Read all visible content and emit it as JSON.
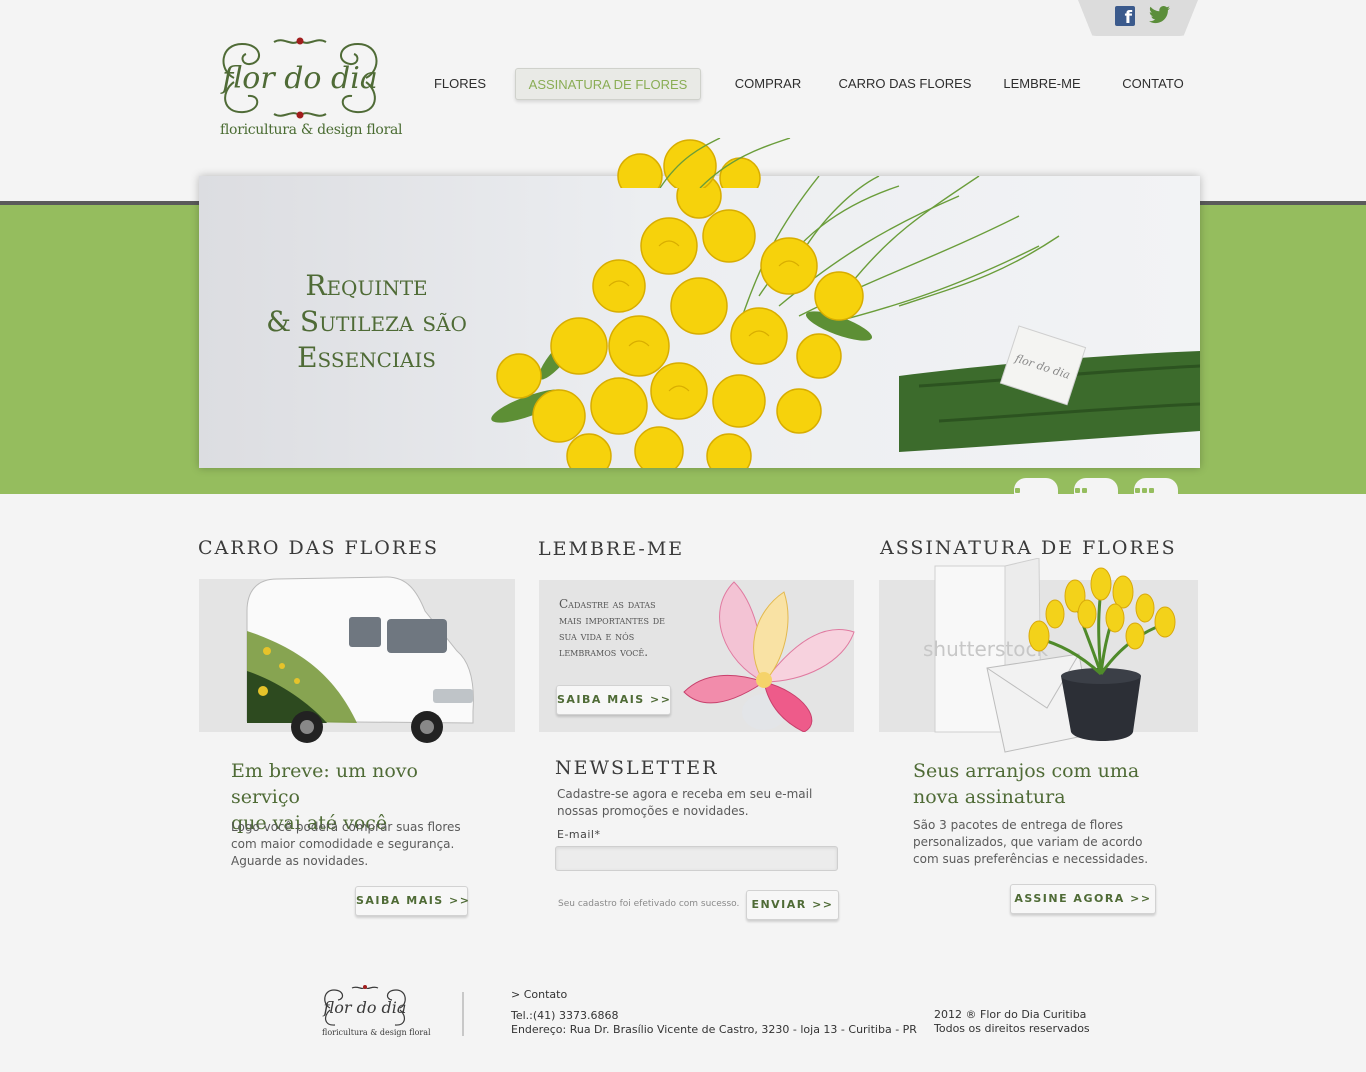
{
  "social": {
    "facebook": "f",
    "twitter": "facebook-twitter"
  },
  "logo": {
    "name": "flor do dia",
    "subtitle": "floricultura & design floral"
  },
  "nav": [
    {
      "label": "FLORES"
    },
    {
      "label": "ASSINATURA DE FLORES",
      "active": true
    },
    {
      "label": "COMPRAR"
    },
    {
      "label": "CARRO DAS FLORES"
    },
    {
      "label": "LEMBRE-ME"
    },
    {
      "label": "CONTATO"
    }
  ],
  "hero": {
    "line1": "Requinte",
    "line2": "& Sutileza são",
    "line3": "Essenciais",
    "tag_text": "flor do dia"
  },
  "slider": {
    "slides": 3,
    "active": 1
  },
  "carro": {
    "title": "CARRO DAS FLORES",
    "heading_line1": "Em breve: um novo serviço",
    "heading_line2": "que vai até você",
    "text_line1": "Logo você poderá comprar suas flores",
    "text_line2": "com maior comodidade e segurança.",
    "text_line3": "Aguarde as novidades.",
    "button": "SAIBA MAIS >>"
  },
  "lembre": {
    "title": "LEMBRE-ME",
    "text": "Cadastre as datas mais importantes de sua vida e nós lembramos você.",
    "button": "SAIBA MAIS >>"
  },
  "newsletter": {
    "title": "NEWSLETTER",
    "desc_line1": "Cadastre-se agora e receba em seu e-mail",
    "desc_line2": "nossas promoções e novidades.",
    "label": "E-mail*",
    "value": "",
    "success": "Seu cadastro foi efetivado com sucesso.",
    "button": "ENVIAR >>"
  },
  "assinatura": {
    "title": "ASSINATURA DE FLORES",
    "watermark": "shutterstock",
    "heading_line1": "Seus arranjos com uma",
    "heading_line2": "nova assinatura",
    "text_line1": "São 3 pacotes de entrega de flores",
    "text_line2": "personalizados, que variam de acordo",
    "text_line3": "com suas preferências e necessidades.",
    "button": "ASSINE AGORA >>"
  },
  "footer": {
    "logo_name": "flor do dia",
    "logo_sub": "floricultura & design floral",
    "contact_link": "> Contato",
    "phone": "Tel.:(41) 3373.6868",
    "address": "Endereço: Rua Dr. Brasílio Vicente de Castro, 3230 - loja 13 - Curitiba - PR",
    "copyright": "2012 ® Flor do Dia Curitiba",
    "rights": "Todos os direitos reservados"
  },
  "colors": {
    "green": "#95bd5e",
    "dark_green": "#4f6b36",
    "background": "#f4f4f4"
  }
}
